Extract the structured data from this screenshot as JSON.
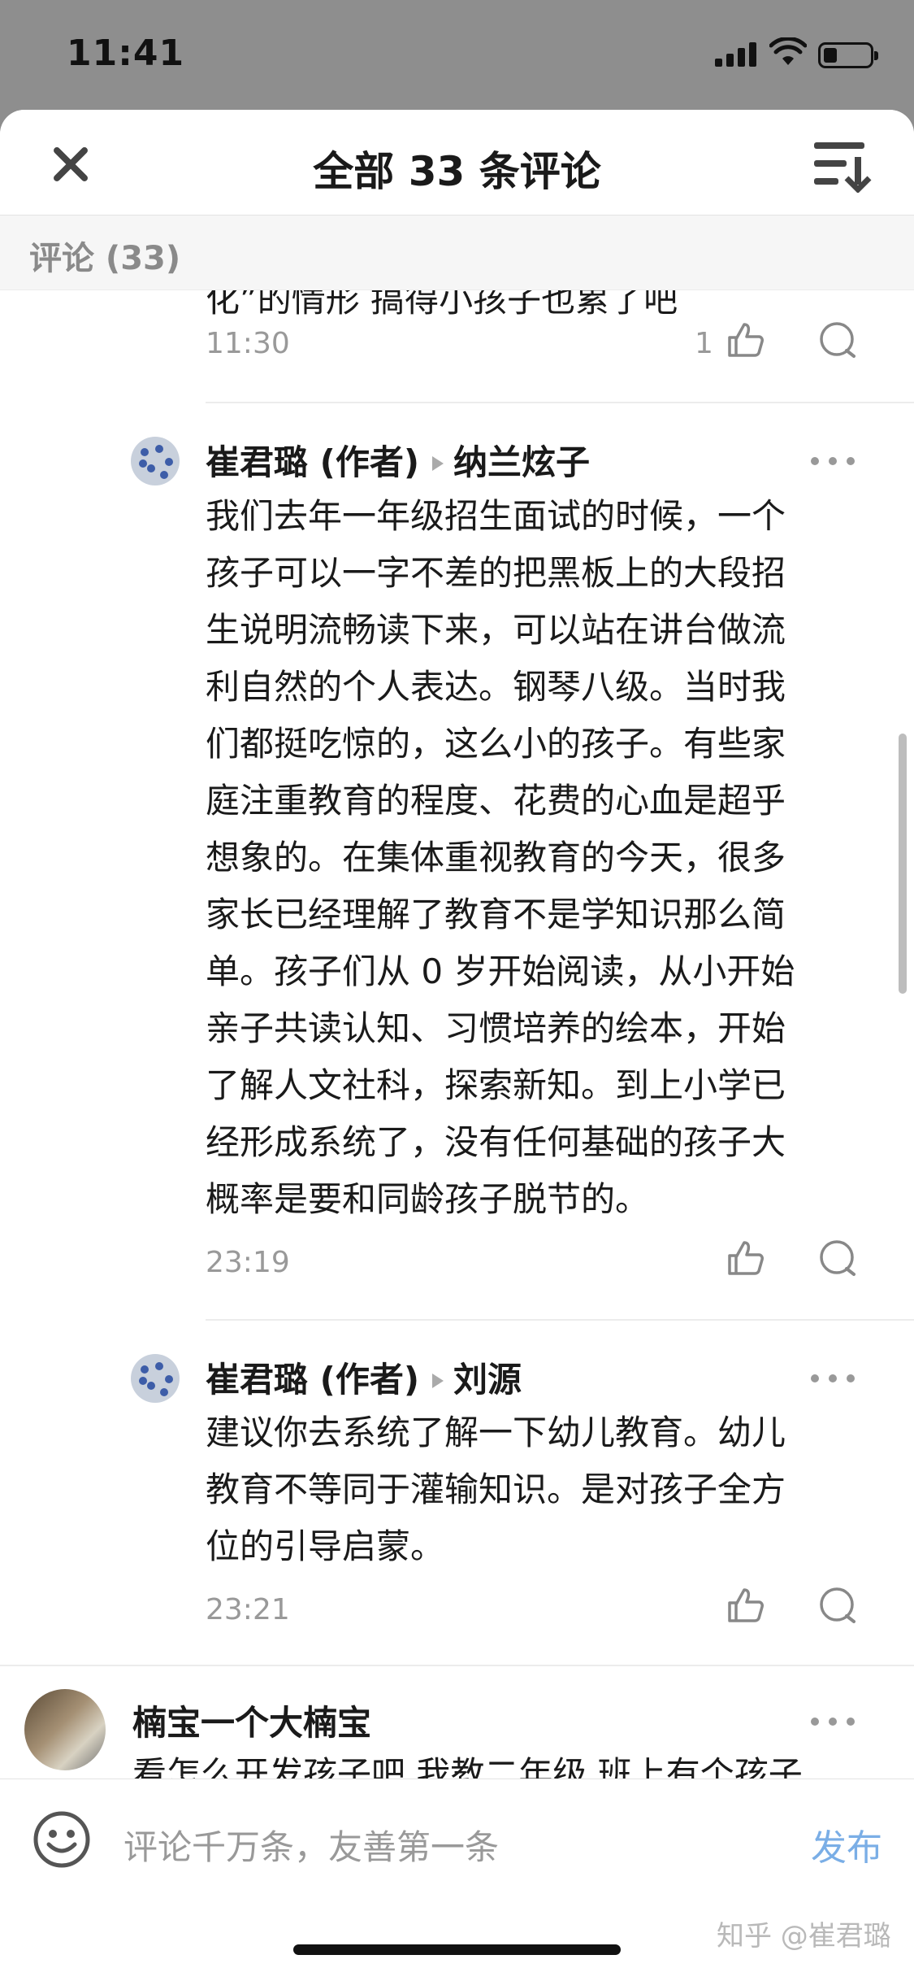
{
  "status_bar": {
    "time": "11:41"
  },
  "header": {
    "title": "全部 33 条评论"
  },
  "subheader": {
    "label": "评论 (33)"
  },
  "top_cut": {
    "partial_text": "化”的情形 搞得小孩子也累了吧",
    "time": "11:30",
    "likes": "1"
  },
  "replies": [
    {
      "author": "崔君璐 (作者)",
      "reply_to": "纳兰炫子",
      "lines": [
        "我们去年一年级招生面试的时候，一个",
        "孩子可以一字不差的把黑板上的大段招",
        "生说明流畅读下来，可以站在讲台做流",
        "利自然的个人表达。钢琴八级。当时我",
        "们都挺吃惊的，这么小的孩子。有些家",
        "庭注重教育的程度、花费的心血是超乎",
        "想象的。在集体重视教育的今天，很多",
        "家长已经理解了教育不是学知识那么简",
        "单。孩子们从 0 岁开始阅读，从小开始",
        "亲子共读认知、习惯培养的绘本，开始",
        "了解人文社科，探索新知。到上小学已",
        "经形成系统了，没有任何基础的孩子大",
        "概率是要和同龄孩子脱节的。"
      ],
      "time": "23:19"
    },
    {
      "author": "崔君璐 (作者)",
      "reply_to": "刘源",
      "lines": [
        "建议你去系统了解一下幼儿教育。幼儿",
        "教育不等同于灌输知识。是对孩子全方",
        "位的引导启蒙。"
      ],
      "time": "23:21"
    }
  ],
  "next_comment": {
    "author": "楠宝一个大楠宝",
    "partial_text": "看怎么开发孩子吧 我教二年级 班上有个孩子"
  },
  "bottom_bar": {
    "placeholder": "评论千万条，友善第一条",
    "publish": "发布",
    "watermark": "知乎 @崔君璐"
  },
  "colors": {
    "accent": "#7aaee6",
    "meta": "#999999",
    "text": "#1a1a1a"
  }
}
